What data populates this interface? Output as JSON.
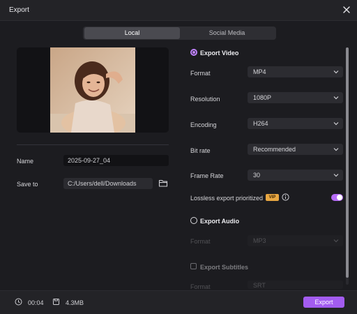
{
  "window": {
    "title": "Export"
  },
  "tabs": [
    {
      "label": "Local",
      "active": true
    },
    {
      "label": "Social Media",
      "active": false
    }
  ],
  "preview": {
    "thumbnail": "portrait-photo"
  },
  "details": {
    "name_label": "Name",
    "name_value": "2025-09-27_04",
    "save_label": "Save to",
    "save_path": "C:/Users/dell/Downloads"
  },
  "export_video": {
    "title": "Export Video",
    "settings": [
      {
        "label": "Format",
        "value": "MP4"
      },
      {
        "label": "Resolution",
        "value": "1080P"
      },
      {
        "label": "Encoding",
        "value": "H264"
      },
      {
        "label": "Bit rate",
        "value": "Recommended"
      },
      {
        "label": "Frame Rate",
        "value": "30"
      }
    ],
    "lossless_label": "Lossless export prioritized",
    "vip_badge": "VIP",
    "lossless_enabled": true
  },
  "export_audio": {
    "title": "Export Audio",
    "format_label": "Format",
    "format_value": "MP3"
  },
  "export_subtitles": {
    "title": "Export Subtitles",
    "format_label": "Format",
    "format_value": "SRT"
  },
  "footer": {
    "duration": "00:04",
    "size": "4.3MB",
    "export_label": "Export"
  },
  "colors": {
    "accent": "#a35cf0",
    "vip": "#e8a742",
    "background": "#1c1c20"
  }
}
